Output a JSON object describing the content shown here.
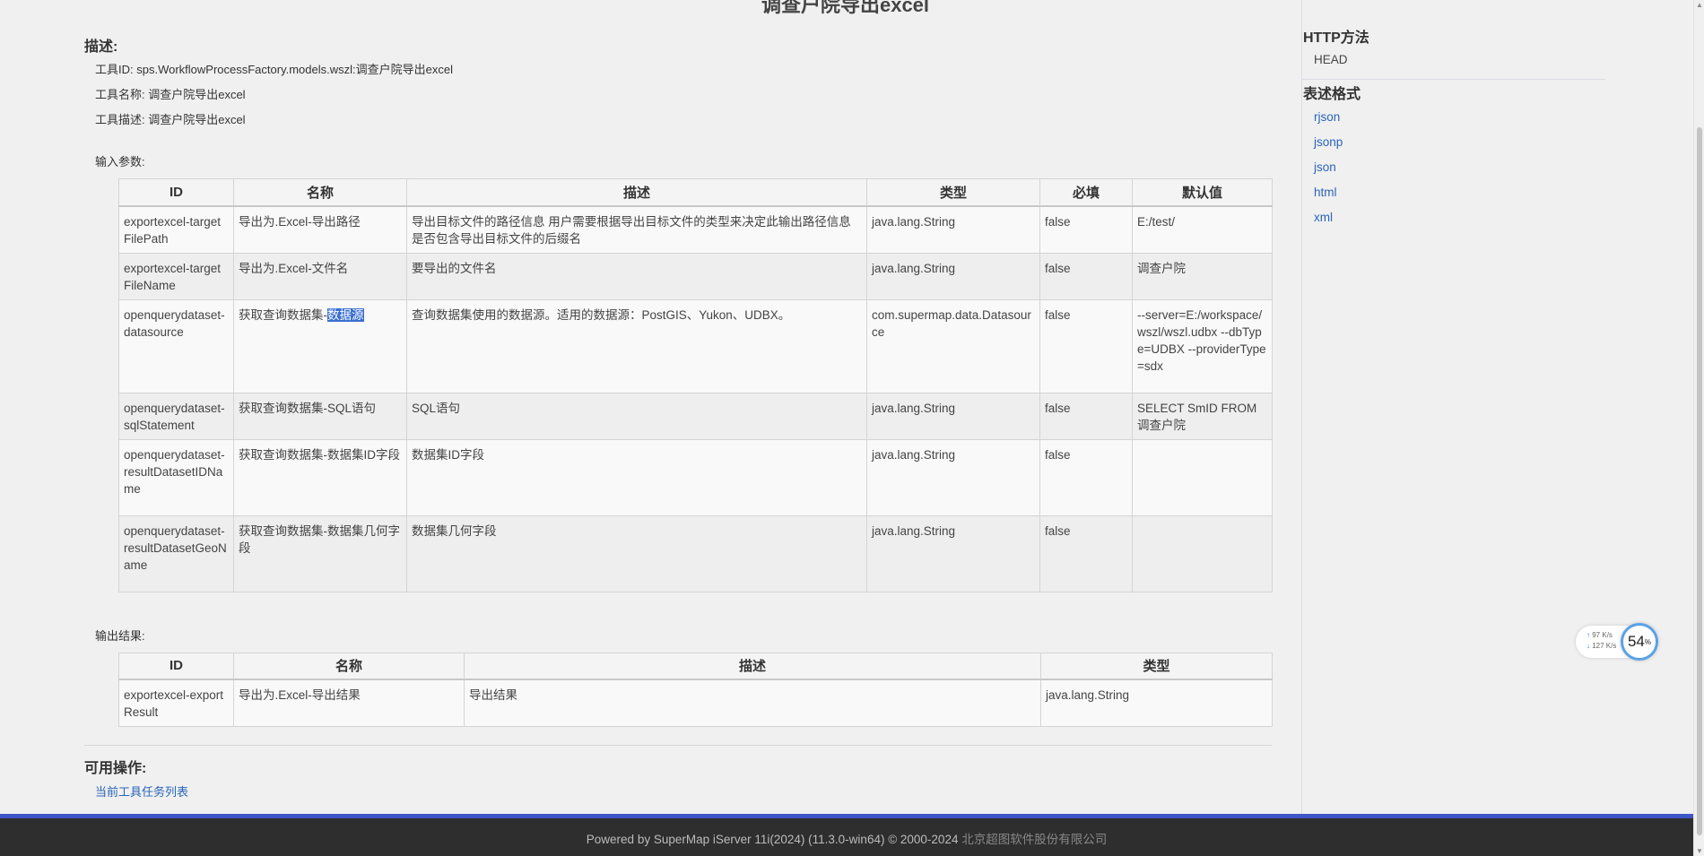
{
  "page": {
    "title": "调查户院导出excel"
  },
  "description": {
    "heading": "描述:",
    "tool_id": "工具ID: sps.WorkflowProcessFactory.models.wszl:调查户院导出excel",
    "tool_name": "工具名称: 调查户院导出excel",
    "tool_desc": "工具描述: 调查户院导出excel"
  },
  "input_params": {
    "label": "输入参数:",
    "headers": [
      "ID",
      "名称",
      "描述",
      "类型",
      "必填",
      "默认值"
    ],
    "rows": [
      [
        "exportexcel-targetFilePath",
        "导出为.Excel-导出路径",
        "导出目标文件的路径信息 用户需要根据导出目标文件的类型来决定此输出路径信息是否包含导出目标文件的后缀名",
        "java.lang.String",
        "false",
        "E:/test/"
      ],
      [
        "exportexcel-targetFileName",
        "导出为.Excel-文件名",
        "要导出的文件名",
        "java.lang.String",
        "false",
        "调查户院"
      ],
      [
        "openquerydataset-datasource",
        "获取查询数据集-",
        "查询数据集使用的数据源。适用的数据源：PostGIS、Yukon、UDBX。",
        "com.supermap.data.Datasource",
        "false",
        "--server=E:/workspace/wszl/wszl.udbx --dbType=UDBX --providerType=sdx"
      ],
      [
        "openquerydataset-sqlStatement",
        "获取查询数据集-SQL语句",
        "SQL语句",
        "java.lang.String",
        "false",
        "SELECT SmID FROM 调查户院"
      ],
      [
        "openquerydataset-resultDatasetIDName",
        "获取查询数据集-数据集ID字段",
        "数据集ID字段",
        "java.lang.String",
        "false",
        ""
      ],
      [
        "openquerydataset-resultDatasetGeoName",
        "获取查询数据集-数据集几何字段",
        "数据集几何字段",
        "java.lang.String",
        "false",
        ""
      ]
    ],
    "selected_text": "数据源"
  },
  "output": {
    "label": "输出结果:",
    "headers": [
      "ID",
      "名称",
      "描述",
      "类型"
    ],
    "rows": [
      [
        "exportexcel-exportResult",
        "导出为.Excel-导出结果",
        "导出结果",
        "java.lang.String"
      ]
    ]
  },
  "operations": {
    "heading": "可用操作:",
    "link": "当前工具任务列表"
  },
  "sidebar": {
    "http_heading": "HTTP方法",
    "http_method": "HEAD",
    "format_heading": "表述格式",
    "formats": [
      "rjson",
      "jsonp",
      "json",
      "html",
      "xml"
    ]
  },
  "footer": {
    "text": "Powered by SuperMap iServer 11i(2024) (11.3.0-win64) © 2000-2024 ",
    "company": "北京超图软件股份有限公司"
  },
  "net_widget": {
    "up": "97 K/s",
    "down": "127 K/s",
    "percent": "54",
    "unit": "%"
  }
}
